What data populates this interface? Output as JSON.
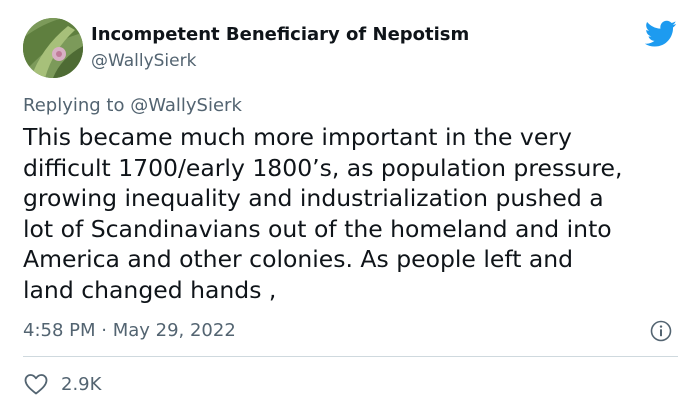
{
  "author": {
    "display_name": "Incompetent Beneficiary of Nepotism",
    "handle": "@WallySierk",
    "avatar_icon": "avatar-photo",
    "platform_icon": "twitter-bird-icon",
    "brand_color": "#1d9bf0"
  },
  "reply": {
    "prefix": "Replying to",
    "handle": "@WallySierk"
  },
  "tweet": {
    "lines": [
      "This became much more important in the very",
      "difficult 1700/early 1800’s, as population pressure,",
      "growing inequality and industrialization pushed a",
      "lot of Scandinavians out of the homeland and into",
      "America and other colonies. As people left and",
      "land changed hands ,"
    ]
  },
  "meta": {
    "timestamp": "4:58 PM · May 29, 2022",
    "info_icon": "info-icon"
  },
  "actions": {
    "like_icon": "heart-icon",
    "like_count": "2.9K"
  }
}
